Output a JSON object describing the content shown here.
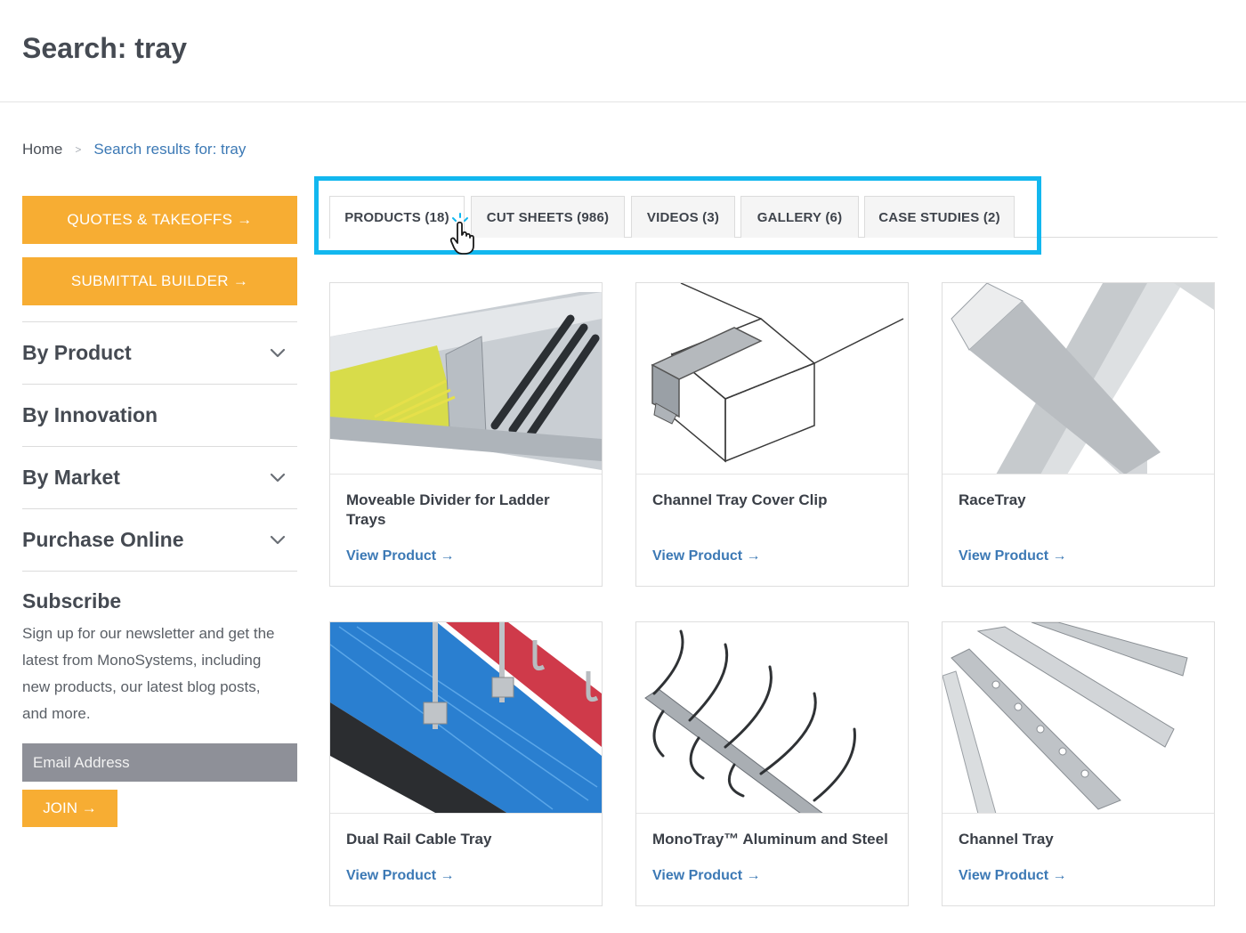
{
  "page": {
    "title": "Search: tray"
  },
  "breadcrumb": {
    "home": "Home",
    "separator": ">",
    "current": "Search results for: tray"
  },
  "sidebar": {
    "quotes_button": "QUOTES & TAKEOFFS →",
    "submittal_button": "SUBMITTAL BUILDER →",
    "nav": [
      {
        "label": "By Product",
        "expandable": true
      },
      {
        "label": "By Innovation",
        "expandable": false
      },
      {
        "label": "By Market",
        "expandable": true
      },
      {
        "label": "Purchase Online",
        "expandable": true
      }
    ],
    "subscribe": {
      "title": "Subscribe",
      "text": "Sign up for our newsletter and get the latest from MonoSystems, including new products, our latest blog posts, and more.",
      "email_placeholder": "Email Address",
      "join_label": "JOIN →"
    }
  },
  "tabs": [
    {
      "label": "PRODUCTS (18)",
      "active": true
    },
    {
      "label": "CUT SHEETS (986)",
      "active": false
    },
    {
      "label": "VIDEOS (3)",
      "active": false
    },
    {
      "label": "GALLERY (6)",
      "active": false
    },
    {
      "label": "CASE STUDIES (2)",
      "active": false
    }
  ],
  "products": [
    {
      "title": "Moveable Divider for Ladder Trays",
      "link": "View Product →",
      "image": "ladder-tray-divider-image"
    },
    {
      "title": "Channel Tray Cover Clip",
      "link": "View Product →",
      "image": "cover-clip-image"
    },
    {
      "title": "RaceTray",
      "link": "View Product →",
      "image": "racetray-image"
    },
    {
      "title": "Dual Rail Cable Tray",
      "link": "View Product →",
      "image": "dual-rail-tray-image"
    },
    {
      "title": "MonoTray™ Aluminum and Steel",
      "link": "View Product →",
      "image": "monotray-image"
    },
    {
      "title": "Channel Tray",
      "link": "View Product →",
      "image": "channel-tray-image"
    }
  ],
  "colors": {
    "accent_orange": "#f7ad33",
    "link_blue": "#3c79b5",
    "highlight_cyan": "#12b7ef"
  }
}
